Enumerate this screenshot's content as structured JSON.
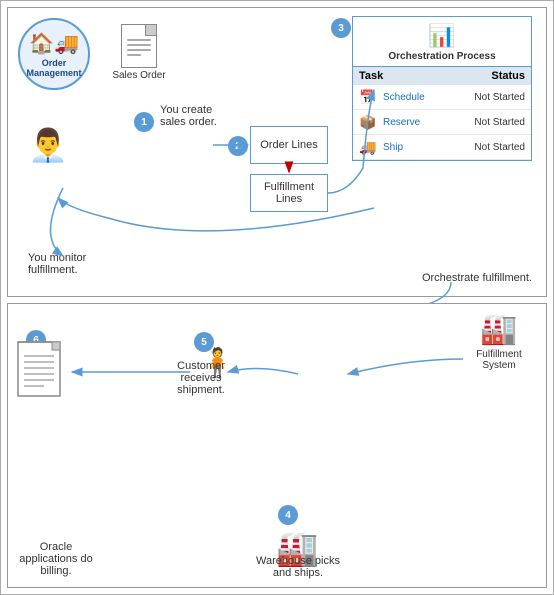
{
  "top_panel": {
    "order_mgmt": {
      "label": "Order Management"
    },
    "sales_order": {
      "label": "Sales Order"
    },
    "step1": {
      "number": "1",
      "text": "You create sales order."
    },
    "step2": {
      "number": "2"
    },
    "step3": {
      "number": "3"
    },
    "order_lines": {
      "label": "Order Lines"
    },
    "fulfillment_lines": {
      "label": "Fulfillment Lines"
    },
    "orchestration": {
      "label": "Orchestration Process",
      "task_header": "Task",
      "status_header": "Status",
      "tasks": [
        {
          "name": "Schedule",
          "status": "Not Started"
        },
        {
          "name": "Reserve",
          "status": "Not Started"
        },
        {
          "name": "Ship",
          "status": "Not Started"
        }
      ]
    },
    "monitor_text": "You monitor fulfillment.",
    "orch_text": "Orchestrate fulfillment."
  },
  "bottom_panel": {
    "fulfillment_system": {
      "label": "Fulfillment System"
    },
    "step4": {
      "number": "4",
      "text": "Warehouse picks and ships."
    },
    "step5": {
      "number": "5",
      "text": "Customer receives shipment."
    },
    "step6": {
      "number": "6",
      "text": "Oracle applications do billing."
    }
  },
  "colors": {
    "blue": "#5b9bd5",
    "dark_blue": "#1a4a8a",
    "red": "#c00000",
    "badge_bg": "#5b9bd5",
    "badge_text": "#ffffff"
  }
}
